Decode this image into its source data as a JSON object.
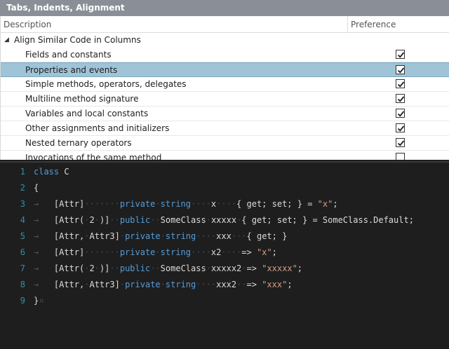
{
  "window": {
    "title": "Tabs, Indents, Alignment"
  },
  "grid": {
    "columns": {
      "description": "Description",
      "preference": "Preference"
    },
    "group": {
      "label": "Align Similar Code in Columns",
      "expanded": true
    },
    "rows": [
      {
        "label": "Fields and constants",
        "checked": true,
        "selected": false
      },
      {
        "label": "Properties and events",
        "checked": true,
        "selected": true
      },
      {
        "label": "Simple methods, operators, delegates",
        "checked": true,
        "selected": false
      },
      {
        "label": "Multiline method signature",
        "checked": true,
        "selected": false
      },
      {
        "label": "Variables and local constants",
        "checked": true,
        "selected": false
      },
      {
        "label": "Other assignments and initializers",
        "checked": true,
        "selected": false
      },
      {
        "label": "Nested ternary operators",
        "checked": true,
        "selected": false
      },
      {
        "label": "Invocations of the same method",
        "checked": false,
        "selected": false
      }
    ]
  },
  "editor": {
    "line_numbers": [
      "1",
      "2",
      "3",
      "4",
      "5",
      "6",
      "7",
      "8",
      "9"
    ],
    "lines": [
      [
        {
          "t": "class",
          "c": "kw"
        },
        {
          "t": " C"
        }
      ],
      [
        {
          "t": "{"
        }
      ],
      [
        {
          "t": "→ ",
          "c": "tabarrow"
        },
        {
          "t": "  [Attr]"
        },
        {
          "t": "·······",
          "c": "ws"
        },
        {
          "t": "private",
          "c": "kw"
        },
        {
          "t": "·",
          "c": "ws"
        },
        {
          "t": "string",
          "c": "kw"
        },
        {
          "t": "····",
          "c": "ws"
        },
        {
          "t": "x"
        },
        {
          "t": "····",
          "c": "ws"
        },
        {
          "t": "{ get; set; } = "
        },
        {
          "t": "\"x\"",
          "c": "str"
        },
        {
          "t": ";"
        }
      ],
      [
        {
          "t": "→ ",
          "c": "tabarrow"
        },
        {
          "t": "  [Attr("
        },
        {
          "t": "·",
          "c": "ws"
        },
        {
          "t": "2"
        },
        {
          "t": "·",
          "c": "ws"
        },
        {
          "t": ")]"
        },
        {
          "t": "··",
          "c": "ws"
        },
        {
          "t": "public",
          "c": "kw"
        },
        {
          "t": "··",
          "c": "ws"
        },
        {
          "t": "SomeClass"
        },
        {
          "t": "·",
          "c": "ws"
        },
        {
          "t": "xxxxx"
        },
        {
          "t": "·",
          "c": "ws"
        },
        {
          "t": "{ get; set; } = SomeClass.Default;"
        }
      ],
      [
        {
          "t": "→ ",
          "c": "tabarrow"
        },
        {
          "t": "  [Attr,"
        },
        {
          "t": "·",
          "c": "ws"
        },
        {
          "t": "Attr3]"
        },
        {
          "t": "·",
          "c": "ws"
        },
        {
          "t": "private",
          "c": "kw"
        },
        {
          "t": "·",
          "c": "ws"
        },
        {
          "t": "string",
          "c": "kw"
        },
        {
          "t": "····",
          "c": "ws"
        },
        {
          "t": "xxx"
        },
        {
          "t": "···",
          "c": "ws"
        },
        {
          "t": "{ get; }"
        }
      ],
      [
        {
          "t": "→ ",
          "c": "tabarrow"
        },
        {
          "t": "  [Attr]"
        },
        {
          "t": "·······",
          "c": "ws"
        },
        {
          "t": "private",
          "c": "kw"
        },
        {
          "t": "·",
          "c": "ws"
        },
        {
          "t": "string",
          "c": "kw"
        },
        {
          "t": "····",
          "c": "ws"
        },
        {
          "t": "x2"
        },
        {
          "t": "····",
          "c": "ws"
        },
        {
          "t": "=> "
        },
        {
          "t": "\"x\"",
          "c": "str"
        },
        {
          "t": ";"
        }
      ],
      [
        {
          "t": "→ ",
          "c": "tabarrow"
        },
        {
          "t": "  [Attr("
        },
        {
          "t": "·",
          "c": "ws"
        },
        {
          "t": "2"
        },
        {
          "t": "·",
          "c": "ws"
        },
        {
          "t": ")]"
        },
        {
          "t": "··",
          "c": "ws"
        },
        {
          "t": "public",
          "c": "kw"
        },
        {
          "t": "··",
          "c": "ws"
        },
        {
          "t": "SomeClass"
        },
        {
          "t": "·",
          "c": "ws"
        },
        {
          "t": "xxxxx2"
        },
        {
          "t": "·",
          "c": "ws"
        },
        {
          "t": "=> "
        },
        {
          "t": "\"xxxxx\"",
          "c": "str"
        },
        {
          "t": ";"
        }
      ],
      [
        {
          "t": "→ ",
          "c": "tabarrow"
        },
        {
          "t": "  [Attr,"
        },
        {
          "t": "·",
          "c": "ws"
        },
        {
          "t": "Attr3]"
        },
        {
          "t": "·",
          "c": "ws"
        },
        {
          "t": "private",
          "c": "kw"
        },
        {
          "t": "·",
          "c": "ws"
        },
        {
          "t": "string",
          "c": "kw"
        },
        {
          "t": "····",
          "c": "ws"
        },
        {
          "t": "xxx2"
        },
        {
          "t": "··",
          "c": "ws"
        },
        {
          "t": "=> "
        },
        {
          "t": "\"xxx\"",
          "c": "str"
        },
        {
          "t": ";"
        }
      ],
      [
        {
          "t": "}"
        },
        {
          "t": "¤",
          "c": "ws"
        }
      ]
    ]
  },
  "colors": {
    "title_bg": "#8a8f97",
    "selection": "#9fc4d8",
    "editor_bg": "#1e1e1e",
    "keyword": "#569cd6",
    "string": "#d69d85",
    "line_number": "#2b91af"
  }
}
